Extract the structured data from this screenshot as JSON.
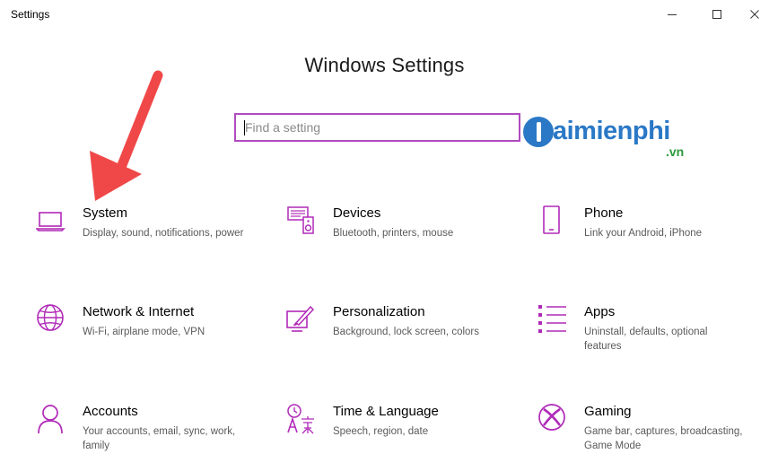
{
  "window": {
    "title": "Settings"
  },
  "header": {
    "title": "Windows Settings"
  },
  "search": {
    "placeholder": "Find a setting",
    "value": ""
  },
  "watermark": {
    "brand": "aimienphi",
    "suffix": ".vn"
  },
  "tiles": [
    {
      "name": "System",
      "desc": "Display, sound, notifications, power",
      "icon": "laptop-icon"
    },
    {
      "name": "Devices",
      "desc": "Bluetooth, printers, mouse",
      "icon": "devices-icon"
    },
    {
      "name": "Phone",
      "desc": "Link your Android, iPhone",
      "icon": "phone-icon"
    },
    {
      "name": "Network & Internet",
      "desc": "Wi-Fi, airplane mode, VPN",
      "icon": "globe-icon"
    },
    {
      "name": "Personalization",
      "desc": "Background, lock screen, colors",
      "icon": "paintbrush-icon"
    },
    {
      "name": "Apps",
      "desc": "Uninstall, defaults, optional features",
      "icon": "apps-list-icon"
    },
    {
      "name": "Accounts",
      "desc": "Your accounts, email, sync, work, family",
      "icon": "person-icon"
    },
    {
      "name": "Time & Language",
      "desc": "Speech, region, date",
      "icon": "time-language-icon"
    },
    {
      "name": "Gaming",
      "desc": "Game bar, captures, broadcasting, Game Mode",
      "icon": "xbox-icon"
    }
  ],
  "colors": {
    "accent": "#b02ab8",
    "search_border": "#b04ac0",
    "annotation_arrow": "#f04848",
    "watermark_blue": "#2a78c6",
    "watermark_green": "#2a9a3a"
  }
}
